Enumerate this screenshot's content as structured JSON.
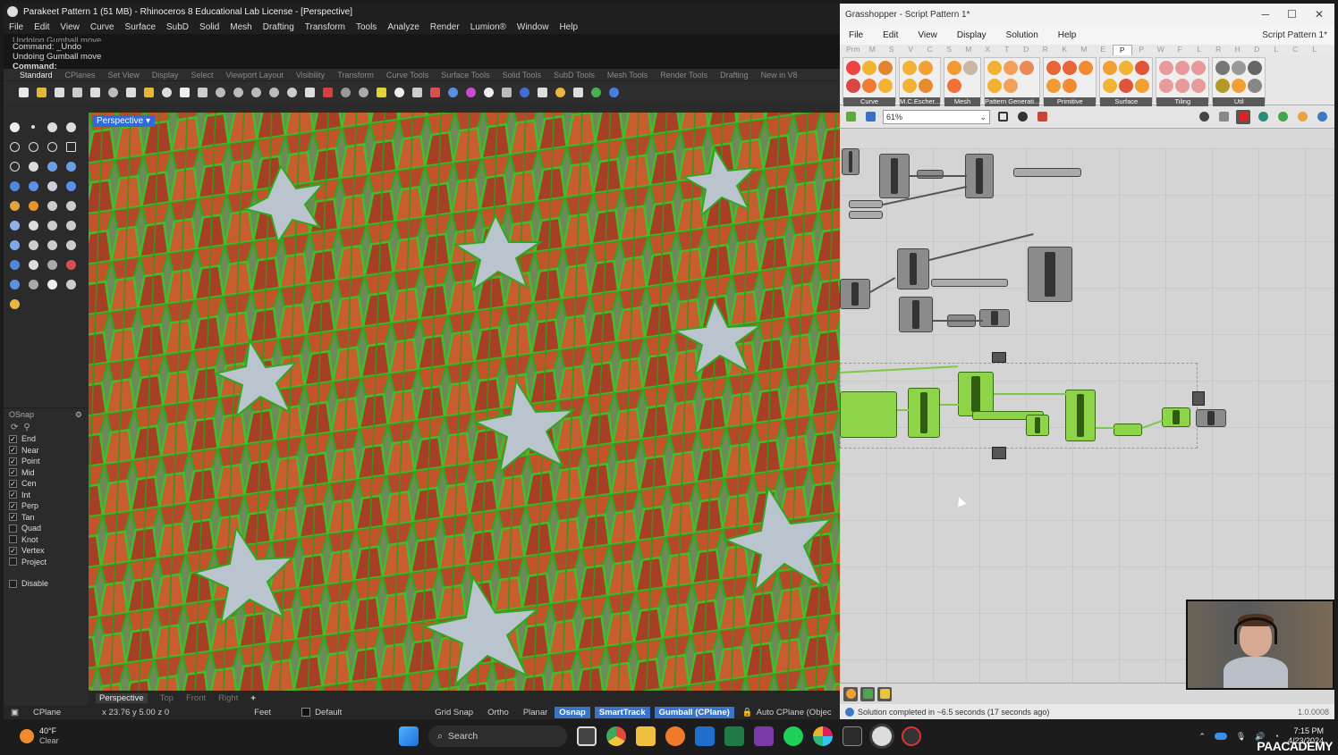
{
  "rhino": {
    "title": "Parakeet Pattern 1 (51 MB) - Rhinoceros 8 Educational Lab License - [Perspective]",
    "menu": [
      "File",
      "Edit",
      "View",
      "Curve",
      "Surface",
      "SubD",
      "Solid",
      "Mesh",
      "Drafting",
      "Transform",
      "Tools",
      "Analyze",
      "Render",
      "Lumion®",
      "Window",
      "Help"
    ],
    "command_history": [
      "Undoing Gumball move",
      "Command: _Undo",
      "Undoing Gumball move"
    ],
    "command_prompt": "Command:",
    "toolbar_tabs": [
      "Standard",
      "CPlanes",
      "Set View",
      "Display",
      "Select",
      "Viewport Layout",
      "Visibility",
      "Transform",
      "Curve Tools",
      "Surface Tools",
      "Solid Tools",
      "SubD Tools",
      "Mesh Tools",
      "Render Tools",
      "Drafting",
      "New in V8"
    ],
    "viewport_label": "Perspective",
    "osnap": {
      "title": "OSnap",
      "items": [
        {
          "label": "End",
          "checked": true
        },
        {
          "label": "Near",
          "checked": true
        },
        {
          "label": "Point",
          "checked": true
        },
        {
          "label": "Mid",
          "checked": true
        },
        {
          "label": "Cen",
          "checked": true
        },
        {
          "label": "Int",
          "checked": true
        },
        {
          "label": "Perp",
          "checked": true
        },
        {
          "label": "Tan",
          "checked": true
        },
        {
          "label": "Quad",
          "checked": false
        },
        {
          "label": "Knot",
          "checked": false
        },
        {
          "label": "Vertex",
          "checked": true
        },
        {
          "label": "Project",
          "checked": false
        }
      ],
      "disable": "Disable"
    },
    "viewport_tabs": [
      "Perspective",
      "Top",
      "Front",
      "Right",
      "+"
    ],
    "status": {
      "cplane": "CPlane",
      "coords": "x 23.76  y 5.00  z 0",
      "units": "Feet",
      "layer": "Default",
      "grid_snap": "Grid Snap",
      "ortho": "Ortho",
      "planar": "Planar",
      "osnap": "Osnap",
      "smarttrack": "SmartTrack",
      "gumball": "Gumball (CPlane)",
      "autocplane": "Auto CPlane (Objec"
    }
  },
  "grasshopper": {
    "title": "Grasshopper - Script Pattern 1*",
    "window_controls": [
      "─",
      "☐",
      "✕"
    ],
    "menu": [
      "File",
      "Edit",
      "View",
      "Display",
      "Solution",
      "Help"
    ],
    "doc_name": "Script Pattern 1*",
    "tabs": [
      "Prm",
      "M",
      "S",
      "V",
      "C",
      "S",
      "M",
      "X",
      "T",
      "D",
      "R",
      "K",
      "M",
      "E",
      "P",
      "P",
      "W",
      "F",
      "L",
      "R",
      "H",
      "D",
      "L",
      "C",
      "L"
    ],
    "active_tab_index": 14,
    "ribbon_groups": [
      "Curve",
      "M.C.Escher...",
      "Mesh",
      "Pattern Generati...",
      "Primitive",
      "Surface",
      "Tiling",
      "Util"
    ],
    "zoom": "61%",
    "status_msg": "Solution completed in ~6.5 seconds (17 seconds ago)",
    "version": "1.0.0008"
  },
  "taskbar": {
    "temp": "40°F",
    "weather": "Clear",
    "search": "Search",
    "time": "7:15 PM",
    "date": "4/23/2024",
    "watermark": "PAACADEMY"
  },
  "colors": {
    "pattern_green": "#32a61e",
    "pattern_orange": "#c2532a",
    "gh_green": "#8ed448",
    "accent_blue": "#2f6ad6"
  }
}
